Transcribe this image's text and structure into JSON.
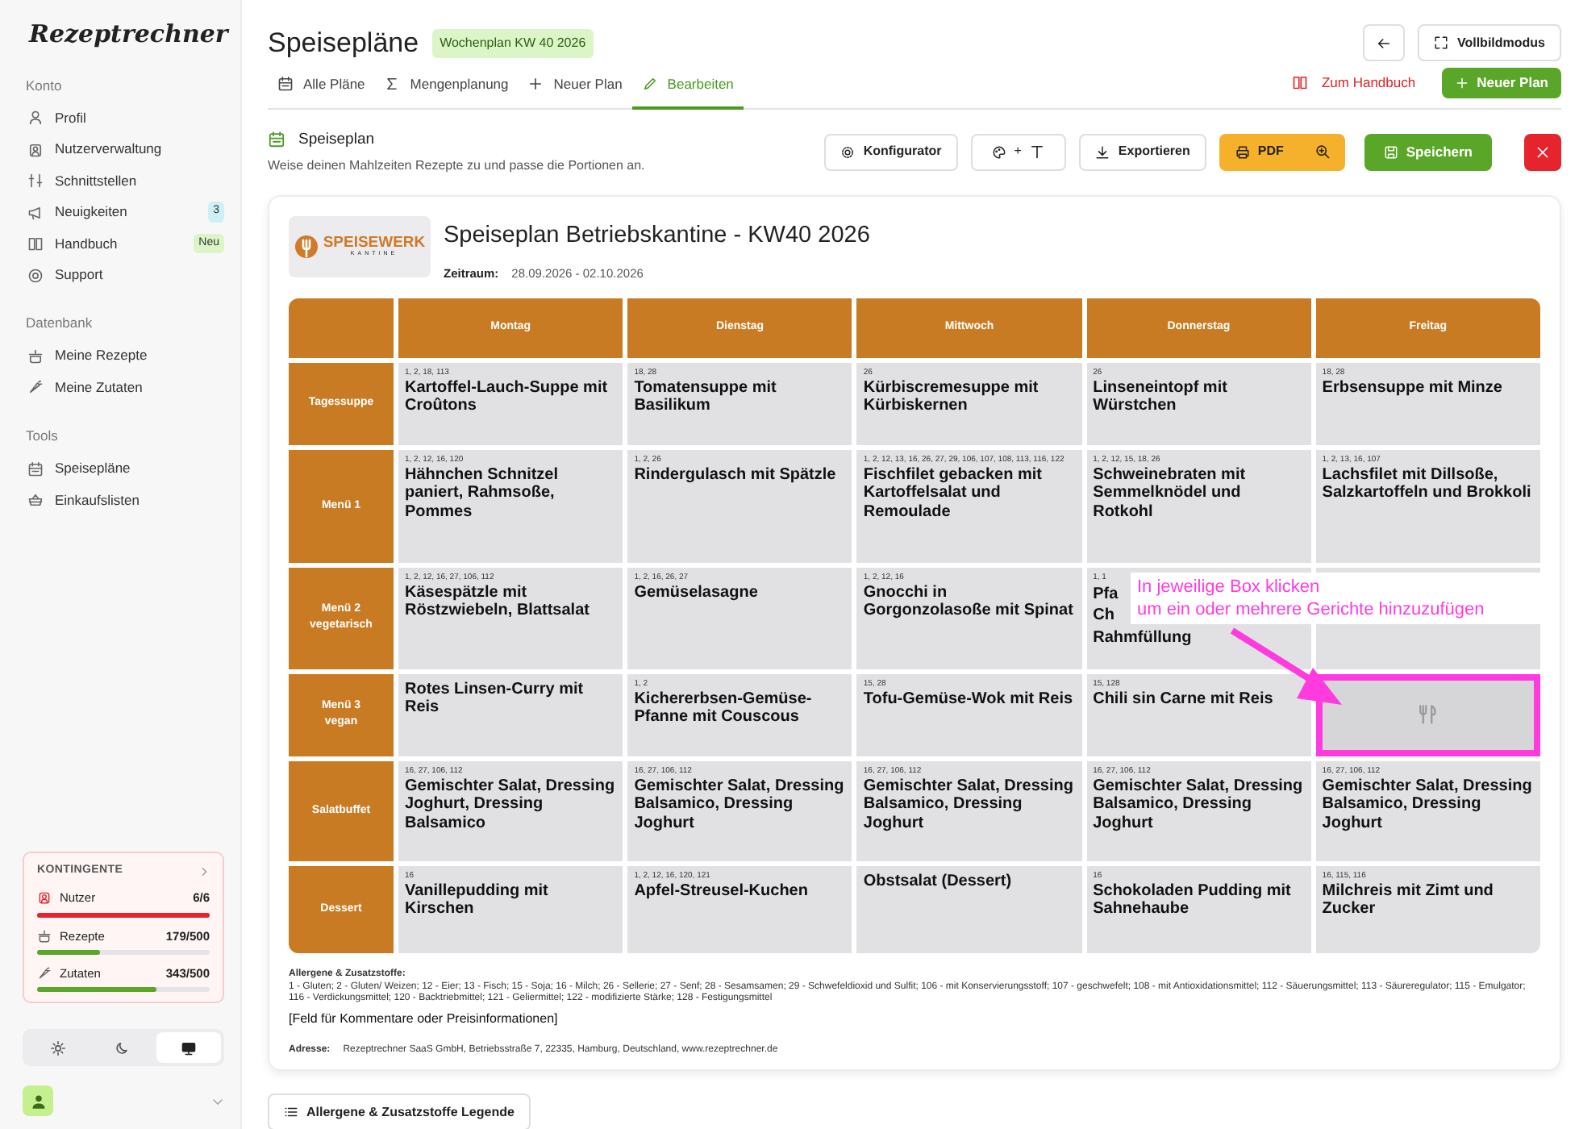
{
  "sidebar": {
    "brand": "Rezeptrechner",
    "sections": [
      {
        "title": "Konto",
        "items": [
          {
            "label": "Profil"
          },
          {
            "label": "Nutzerverwaltung"
          },
          {
            "label": "Schnittstellen"
          },
          {
            "label": "Neuigkeiten",
            "badge": {
              "text": "3",
              "color": "#cdeff8"
            }
          },
          {
            "label": "Handbuch",
            "badge": {
              "text": "Neu",
              "color": "#dcf5c8"
            }
          },
          {
            "label": "Support"
          }
        ]
      },
      {
        "title": "Datenbank",
        "items": [
          {
            "label": "Meine Rezepte"
          },
          {
            "label": "Meine Zutaten"
          }
        ]
      },
      {
        "title": "Tools",
        "items": [
          {
            "label": "Speisepläne"
          },
          {
            "label": "Einkaufslisten"
          }
        ]
      }
    ],
    "quota": {
      "title": "KONTINGENTE",
      "items": [
        {
          "label": "Nutzer",
          "reading": "6/6",
          "level": 1.0,
          "color": "#e5242e"
        },
        {
          "label": "Rezepte",
          "reading": "179/500",
          "level": 0.36,
          "color": "#5aa628"
        },
        {
          "label": "Zutaten",
          "reading": "343/500",
          "level": 0.69,
          "color": "#5aa628"
        }
      ]
    },
    "theme": [
      {
        "selected": false
      },
      {
        "selected": false
      },
      {
        "selected": true
      }
    ]
  },
  "header": {
    "title": "Speisepläne",
    "badge": "Wochenplan KW 40 2026",
    "fullscreen": "Vollbildmodus",
    "tabs": [
      {
        "label": "Alle Pläne",
        "selected": false
      },
      {
        "label": "Mengenplanung",
        "selected": false
      },
      {
        "label": "Neuer Plan",
        "selected": false
      },
      {
        "label": "Bearbeiten",
        "selected": true
      }
    ],
    "manual_link": "Zum Handbuch",
    "new_plan": "Neuer Plan"
  },
  "section": {
    "title": "Speiseplan",
    "subtitle": "Weise deinen Mahlzeiten Rezepte zu und passe die Portionen an.",
    "toolbar": {
      "configurator": "Konfigurator",
      "style_plus": "+",
      "export": "Exportieren",
      "pdf": "PDF",
      "save": "Speichern"
    }
  },
  "plan": {
    "logo": {
      "name": "SPEISEWERK",
      "sub": "KANTINE"
    },
    "title": "Speiseplan Betriebskantine - KW40 2026",
    "period_label": "Zeitraum:",
    "period": "28.09.2026 - 02.10.2026",
    "table": {
      "columns": [
        "Montag",
        "Dienstag",
        "Mittwoch",
        "Donnerstag",
        "Freitag"
      ],
      "rows": [
        {
          "label": "Tagessuppe",
          "cells": [
            {
              "allergens": "1, 2, 18, 113",
              "dish": "Kartoffel-Lauch-Suppe mit Croûtons"
            },
            {
              "allergens": "18, 28",
              "dish": "Tomatensuppe mit Basilikum"
            },
            {
              "allergens": "26",
              "dish": "Kürbiscremesuppe mit Kürbiskernen"
            },
            {
              "allergens": "26",
              "dish": "Linseneintopf mit Würstchen"
            },
            {
              "allergens": "18, 28",
              "dish": "Erbsensuppe mit Minze"
            }
          ]
        },
        {
          "label": "Menü 1",
          "cells": [
            {
              "allergens": "1, 2, 12, 16, 120",
              "dish": "Hähnchen Schnitzel paniert, Rahmsoße, Pommes"
            },
            {
              "allergens": "1, 2, 26",
              "dish": "Rindergulasch mit Spätzle"
            },
            {
              "allergens": "1, 2, 12, 13, 16, 26, 27, 29, 106, 107, 108, 113, 116, 122",
              "dish": "Fischfilet gebacken mit Kartoffelsalat und Remoulade"
            },
            {
              "allergens": "1, 2, 12, 15, 18, 26",
              "dish": "Schweinebraten mit Semmelknödel und Rotkohl"
            },
            {
              "allergens": "1, 2, 13, 16, 107",
              "dish": "Lachsfilet mit Dillsoße, Salzkartoffeln und Brokkoli"
            }
          ]
        },
        {
          "label": "Menü 2",
          "sublabel": "vegetarisch",
          "cells": [
            {
              "allergens": "1, 2, 12, 16, 27, 106, 112",
              "dish": "Käsespätzle mit Röstzwiebeln, Blattsalat"
            },
            {
              "allergens": "1, 2, 16, 26, 27",
              "dish": "Gemüselasagne"
            },
            {
              "allergens": "1, 2, 12, 16",
              "dish": "Gnocchi in Gorgonzolasoße mit Spinat"
            },
            {
              "kind": "covered",
              "allergens": "1, 1",
              "lines": [
                "Pfa",
                "Ch",
                "Rahmfüllung"
              ]
            },
            {
              "kind": "covered"
            }
          ]
        },
        {
          "label": "Menü 3",
          "sublabel": "vegan",
          "cells": [
            {
              "dish": "Rotes Linsen-Curry mit Reis"
            },
            {
              "allergens": "1, 2",
              "dish": "Kichererbsen-Gemüse-Pfanne mit Couscous"
            },
            {
              "allergens": "15, 28",
              "dish": "Tofu-Gemüse-Wok mit Reis"
            },
            {
              "allergens": "15, 128",
              "dish": "Chili sin Carne mit Reis"
            },
            {
              "kind": "empty",
              "highlighted": true
            }
          ]
        },
        {
          "label": "Salatbuffet",
          "cells": [
            {
              "allergens": "16, 27, 106, 112",
              "dish": "Gemischter Salat, Dressing Joghurt, Dressing Balsamico"
            },
            {
              "allergens": "16, 27, 106, 112",
              "dish": "Gemischter Salat, Dressing Balsamico, Dressing Joghurt"
            },
            {
              "allergens": "16, 27, 106, 112",
              "dish": "Gemischter Salat, Dressing Balsamico, Dressing Joghurt"
            },
            {
              "allergens": "16, 27, 106, 112",
              "dish": "Gemischter Salat, Dressing Balsamico, Dressing Joghurt"
            },
            {
              "allergens": "16, 27, 106, 112",
              "dish": "Gemischter Salat, Dressing Balsamico, Dressing Joghurt"
            }
          ]
        },
        {
          "label": "Dessert",
          "cells": [
            {
              "allergens": "16",
              "dish": "Vanillepudding mit Kirschen"
            },
            {
              "allergens": "1, 2, 12, 16, 120, 121",
              "dish": "Apfel-Streusel-Kuchen"
            },
            {
              "dish": "Obstsalat (Dessert)"
            },
            {
              "allergens": "16",
              "dish": "Schokoladen Pudding mit Sahnehaube"
            },
            {
              "allergens": "16, 115, 116",
              "dish": "Milchreis mit Zimt und Zucker"
            }
          ]
        }
      ]
    },
    "annotation": {
      "lines": [
        "In jeweilige Box klicken",
        "um ein oder mehrere Gerichte hinzuzufügen"
      ]
    },
    "allergens_title": "Allergene & Zusatzstoffe:",
    "allergens_text": "1 - Gluten; 2 - Gluten/ Weizen; 12 - Eier; 13 - Fisch; 15 - Soja; 16 - Milch; 26 - Sellerie; 27 - Senf; 28 - Sesamsamen; 29 - Schwefeldioxid und Sulfit; 106 - mit Konservierungsstoff; 107 - geschwefelt; 108 - mit Antioxidationsmittel; 112 - Säuerungsmittel; 113 - Säureregulator; 115 - Emulgator; 116 - Verdickungsmittel; 120 - Backtriebmittel; 121 - Geliermittel; 122 - modifizierte Stärke; 128 - Festigungsmittel",
    "comment": "[Feld für Kommentare oder Preisinformationen]",
    "address_label": "Adresse:",
    "address": "Rezeptrechner SaaS GmbH, Betriebsstraße 7, 22335, Hamburg, Deutschland, www.rezeptrechner.de"
  },
  "legend_button": "Allergene & Zusatzstoffe Legende"
}
